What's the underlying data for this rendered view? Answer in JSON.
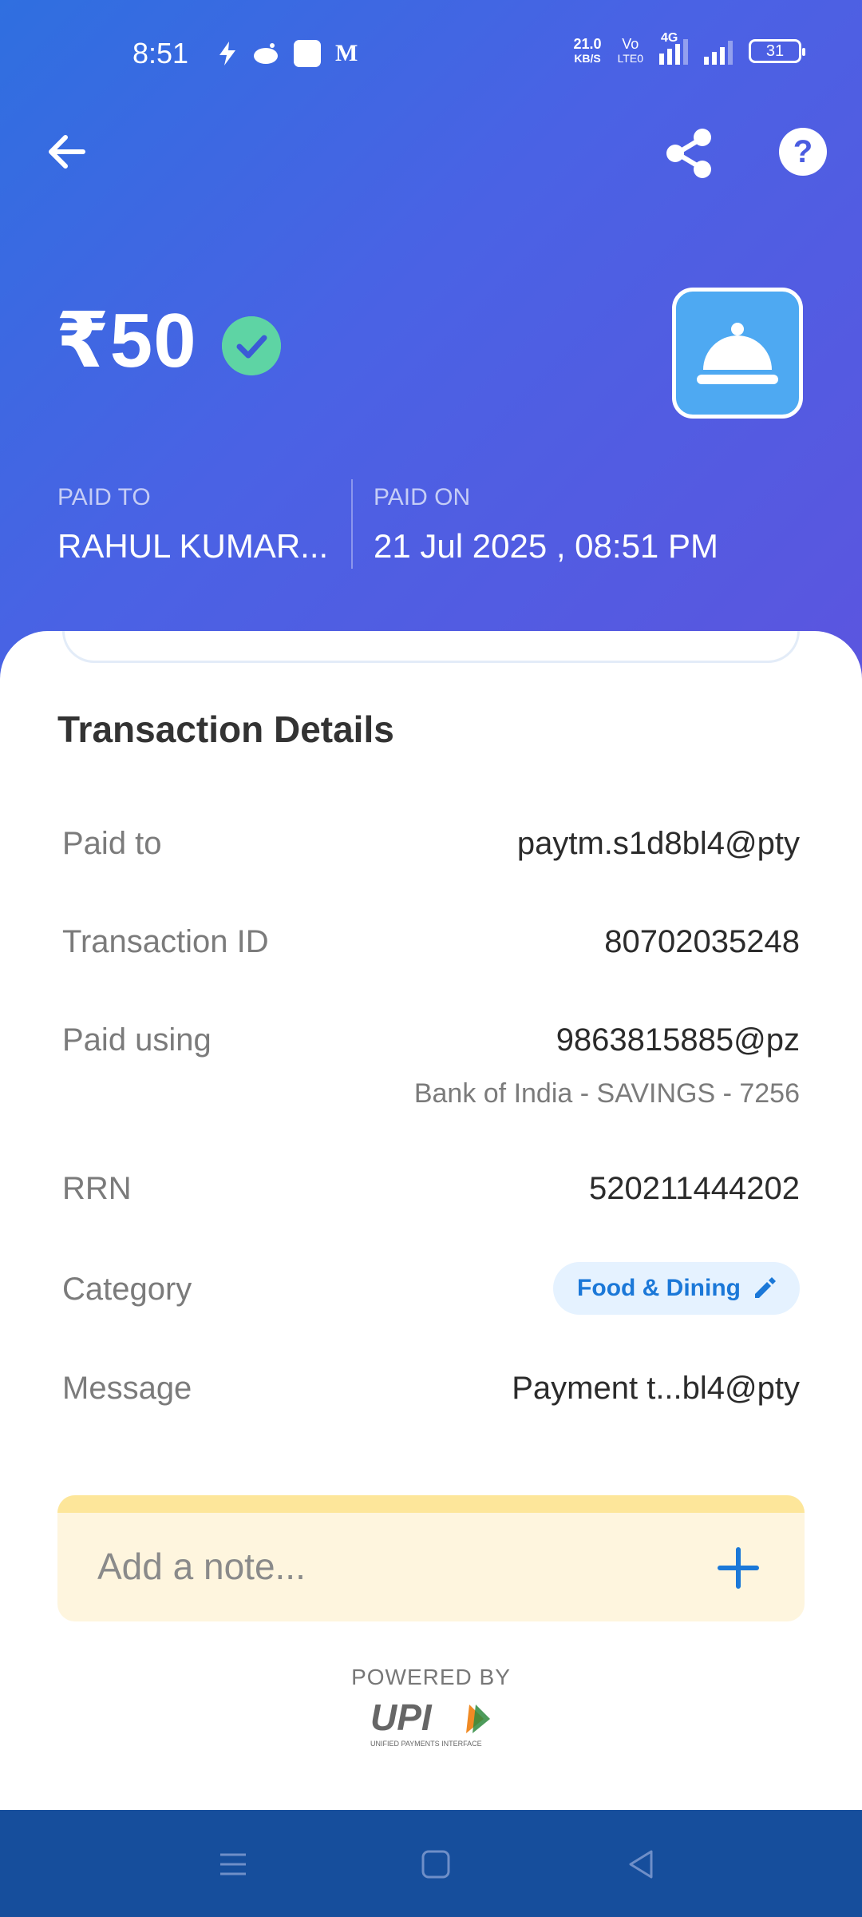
{
  "status_bar": {
    "time": "8:51",
    "net_speed_value": "21.0",
    "net_speed_unit": "KB/S",
    "volte_top": "Vo",
    "volte_bottom": "LTE0",
    "network_type": "4G",
    "battery": "31",
    "notification_icons": [
      "lightning-icon",
      "reddit-icon",
      "app-icon",
      "gmail-icon"
    ]
  },
  "header": {
    "back_icon": "arrow-left-icon",
    "share_icon": "share-icon",
    "help_icon": "help-icon",
    "help_glyph": "?"
  },
  "payment": {
    "amount": "₹50",
    "status": "success-check-icon",
    "merchant_icon": "food-cloche-icon",
    "paid_to_label": "PAID TO",
    "paid_to_value": "RAHUL KUMAR...",
    "paid_on_label": "PAID ON",
    "paid_on_value": "21 Jul 2025 , 08:51 PM"
  },
  "details": {
    "title": "Transaction Details",
    "rows": [
      {
        "label": "Paid to",
        "value": "paytm.s1d8bl4@pty"
      },
      {
        "label": "Transaction ID",
        "value": "80702035248"
      },
      {
        "label": "Paid using",
        "value": "9863815885@pz",
        "sub": "Bank of India - SAVINGS - 7256"
      },
      {
        "label": "RRN",
        "value": "520211444202"
      },
      {
        "label": "Category",
        "value": "Food & Dining"
      },
      {
        "label": "Message",
        "value": "Payment t...bl4@pty"
      }
    ]
  },
  "note": {
    "placeholder": "Add a note...",
    "add_icon": "plus-icon"
  },
  "footer": {
    "powered_by": "POWERED BY",
    "logo_text": "UPI",
    "logo_caption": "UNIFIED PAYMENTS INTERFACE"
  },
  "nav_bar": {
    "buttons": [
      "menu-icon",
      "home-icon",
      "back-triangle-icon"
    ]
  },
  "colors": {
    "hero_start": "#2f6fe0",
    "hero_end": "#5b55df",
    "success": "#5ed4a4",
    "merchant_tile": "#4ea9f2",
    "chip_bg": "#e5f2ff",
    "chip_text": "#1b78d8",
    "note_bg": "#fef5de",
    "navbar": "#164e9c"
  }
}
